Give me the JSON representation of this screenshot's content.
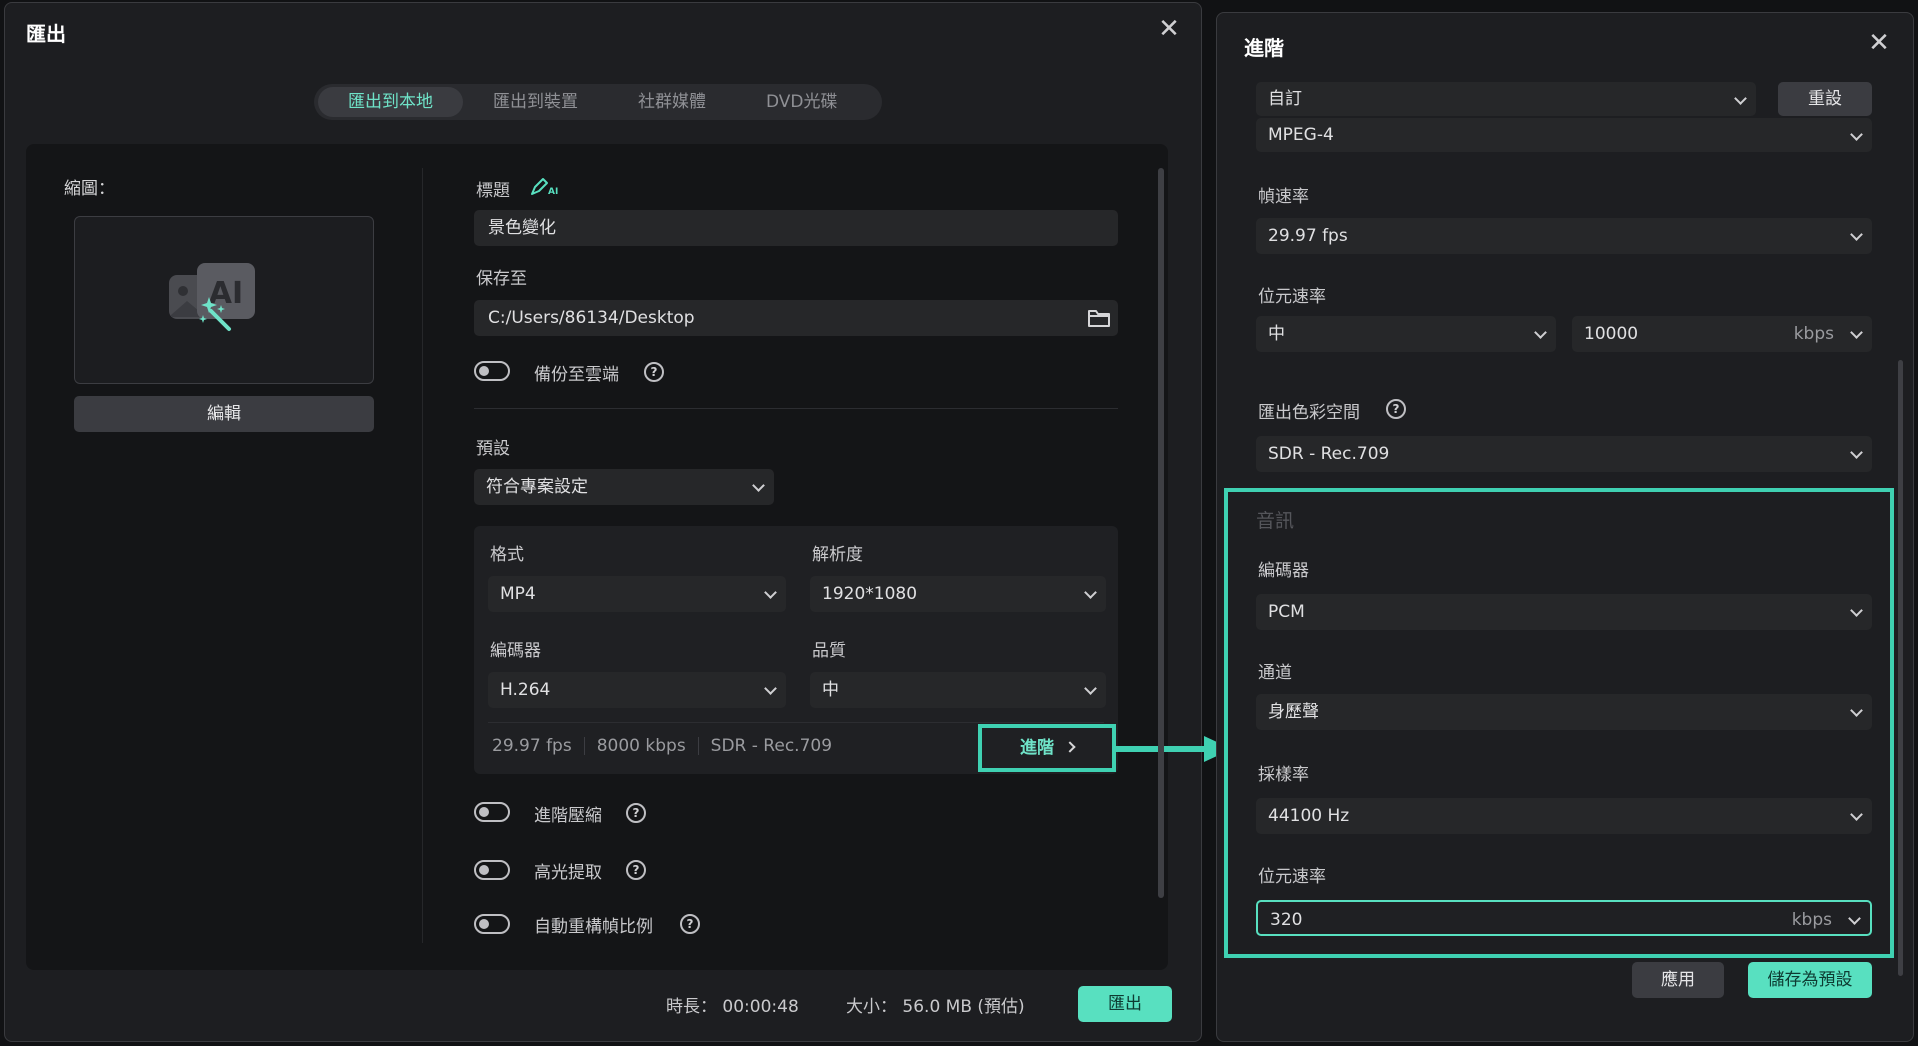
{
  "export_dialog": {
    "title": "匯出",
    "tabs": [
      "匯出到本地",
      "匯出到裝置",
      "社群媒體",
      "DVD光碟"
    ],
    "thumbnail_label": "縮圖：",
    "thumbnail_art": "AI",
    "edit_button": "編輯",
    "title_label": "標題",
    "title_value": "景色變化",
    "save_to_label": "保存至",
    "save_path": "C:/Users/86134/Desktop",
    "backup_cloud_label": "備份至雲端",
    "preset_label": "預設",
    "preset_value": "符合專案設定",
    "format_label": "格式",
    "format_value": "MP4",
    "resolution_label": "解析度",
    "resolution_value": "1920*1080",
    "encoder_label": "編碼器",
    "encoder_value": "H.264",
    "quality_label": "品質",
    "quality_value": "中",
    "summary": {
      "fps": "29.97 fps",
      "bitrate": "8000 kbps",
      "color_space": "SDR - Rec.709"
    },
    "advanced_button": "進階",
    "advanced_compression_label": "進階壓縮",
    "highlight_extract_label": "高光提取",
    "auto_reframe_label": "自動重構幀比例",
    "help_glyph": "?",
    "close_glyph": "✕",
    "duration_label": "時長：",
    "duration_value": "00:00:48",
    "size_label": "大小：",
    "size_value": "56.0 MB (預估)",
    "export_button": "匯出"
  },
  "advanced_panel": {
    "title": "進階",
    "close_glyph": "✕",
    "profile_value": "自訂",
    "reset_button": "重設",
    "video_encoder_value": "MPEG-4",
    "frame_rate_label": "幀速率",
    "frame_rate_value": "29.97 fps",
    "video_bitrate_label": "位元速率",
    "video_bitrate_level": "中",
    "video_bitrate_value": "10000",
    "video_bitrate_unit": "kbps",
    "color_space_label": "匯出色彩空間",
    "color_space_value": "SDR - Rec.709",
    "audio_section_label": "音訊",
    "audio_encoder_label": "編碼器",
    "audio_encoder_value": "PCM",
    "channel_label": "通道",
    "channel_value": "身歷聲",
    "sample_rate_label": "採樣率",
    "sample_rate_value": "44100 Hz",
    "audio_bitrate_label": "位元速率",
    "audio_bitrate_value": "320",
    "audio_bitrate_unit": "kbps",
    "apply_button": "應用",
    "save_preset_button": "儲存為預設"
  },
  "colors": {
    "accent": "#58e0c0",
    "highlight_border": "#3fd1b2",
    "panel_bg": "#1d1e21",
    "field_bg": "#262729"
  },
  "icons": [
    "close-icon",
    "ai-pen-icon",
    "folder-icon",
    "help-icon",
    "chevron-down-icon",
    "chevron-right-icon",
    "arrow-right-icon",
    "ai-image-icon"
  ]
}
